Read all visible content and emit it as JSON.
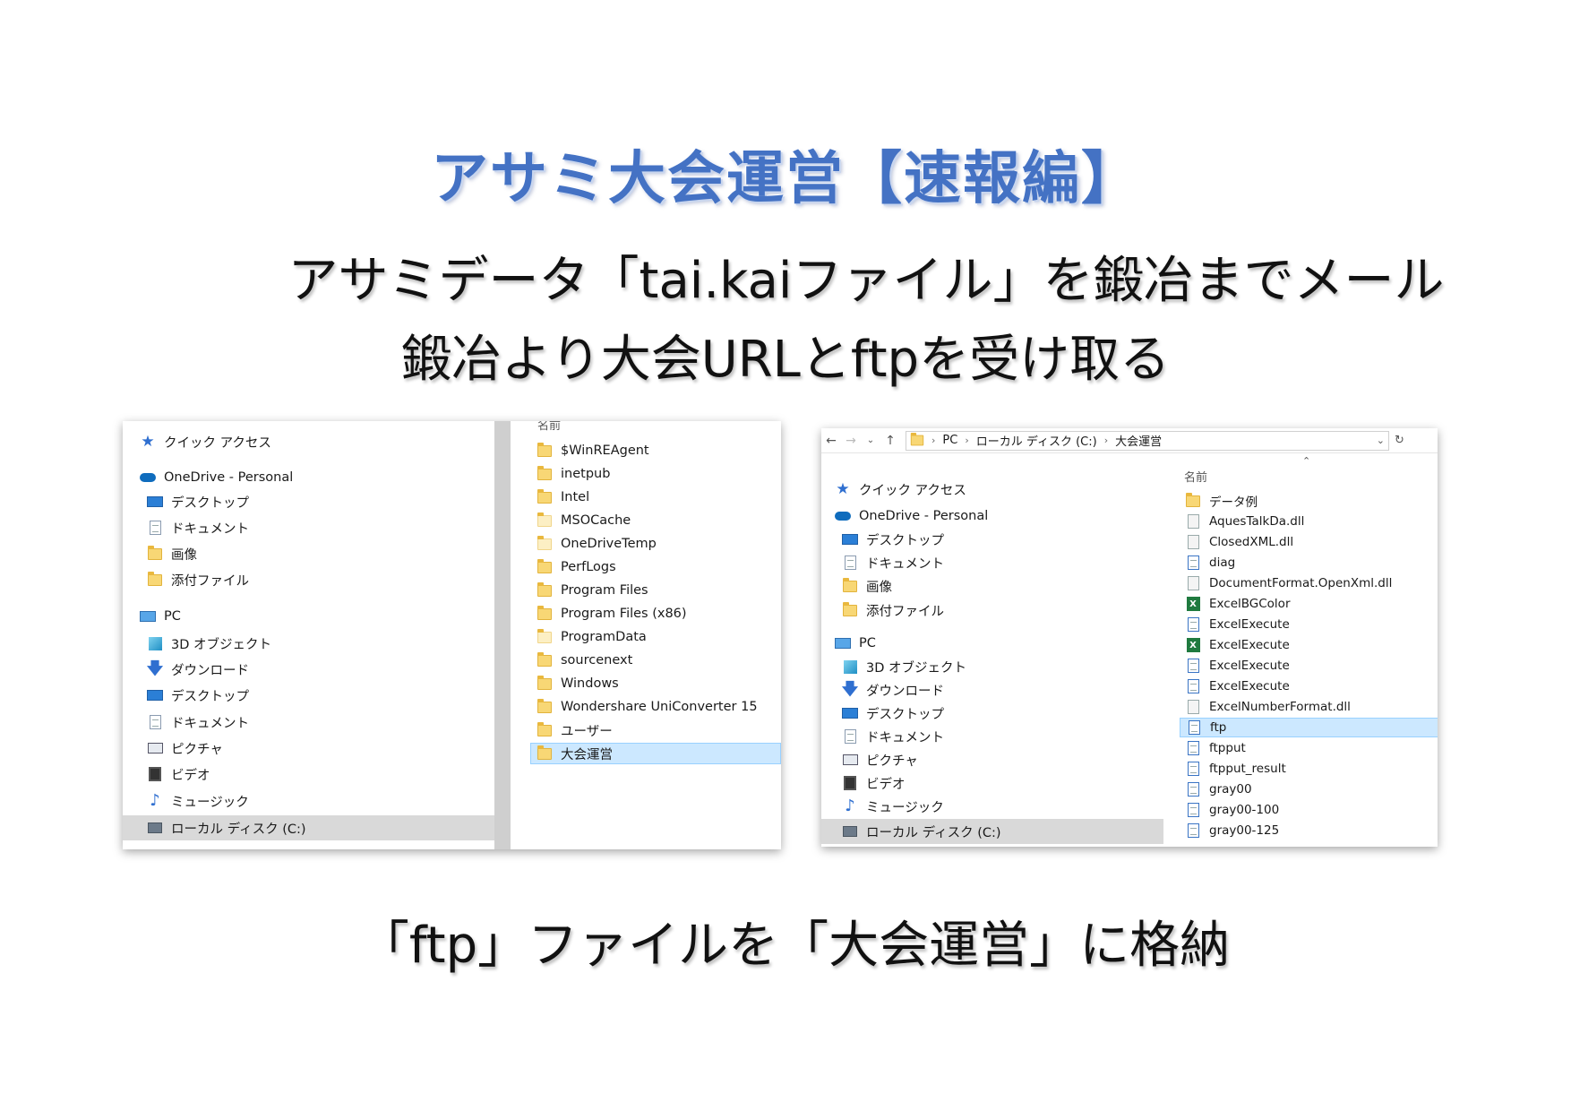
{
  "slide": {
    "title": "アサミ大会運営【速報編】",
    "line1": "アサミデータ「tai.kaiファイル」を鍛冶までメール",
    "line2": "鍛冶より大会URLとftpを受け取る",
    "line3": "「ftp」ファイルを「大会運営」に格納"
  },
  "left_explorer": {
    "nav": [
      {
        "label": "クイック アクセス",
        "icon": "star-icon"
      },
      {
        "label": "OneDrive - Personal",
        "icon": "cloud-icon"
      },
      {
        "label": "デスクトップ",
        "icon": "desktop-icon"
      },
      {
        "label": "ドキュメント",
        "icon": "document-icon"
      },
      {
        "label": "画像",
        "icon": "folder-icon"
      },
      {
        "label": "添付ファイル",
        "icon": "folder-icon"
      },
      {
        "label": "PC",
        "icon": "pc-icon"
      },
      {
        "label": "3D オブジェクト",
        "icon": "cube-icon"
      },
      {
        "label": "ダウンロード",
        "icon": "download-arrow-icon"
      },
      {
        "label": "デスクトップ",
        "icon": "desktop-icon"
      },
      {
        "label": "ドキュメント",
        "icon": "document-icon"
      },
      {
        "label": "ピクチャ",
        "icon": "picture-icon"
      },
      {
        "label": "ビデオ",
        "icon": "video-icon"
      },
      {
        "label": "ミュージック",
        "icon": "music-note-icon"
      },
      {
        "label": "ローカル ディスク (C:)",
        "icon": "drive-icon"
      }
    ],
    "column_header": "名前",
    "files": [
      "$WinREAgent",
      "inetpub",
      "Intel",
      "MSOCache",
      "OneDriveTemp",
      "PerfLogs",
      "Program Files",
      "Program Files (x86)",
      "ProgramData",
      "sourcenext",
      "Windows",
      "Wondershare UniConverter 15",
      "ユーザー",
      "大会運営"
    ]
  },
  "right_explorer": {
    "address": {
      "crumbs": [
        "PC",
        "ローカル ディスク (C:)",
        "大会運営"
      ]
    },
    "nav": [
      {
        "label": "クイック アクセス",
        "icon": "star-icon"
      },
      {
        "label": "OneDrive - Personal",
        "icon": "cloud-icon"
      },
      {
        "label": "デスクトップ",
        "icon": "desktop-icon"
      },
      {
        "label": "ドキュメント",
        "icon": "document-icon"
      },
      {
        "label": "画像",
        "icon": "folder-icon"
      },
      {
        "label": "添付ファイル",
        "icon": "folder-icon"
      },
      {
        "label": "PC",
        "icon": "pc-icon"
      },
      {
        "label": "3D オブジェクト",
        "icon": "cube-icon"
      },
      {
        "label": "ダウンロード",
        "icon": "download-arrow-icon"
      },
      {
        "label": "デスクトップ",
        "icon": "desktop-icon"
      },
      {
        "label": "ドキュメント",
        "icon": "document-icon"
      },
      {
        "label": "ピクチャ",
        "icon": "picture-icon"
      },
      {
        "label": "ビデオ",
        "icon": "video-icon"
      },
      {
        "label": "ミュージック",
        "icon": "music-note-icon"
      },
      {
        "label": "ローカル ディスク (C:)",
        "icon": "drive-icon"
      }
    ],
    "column_header": "名前",
    "files": [
      {
        "name": "データ例",
        "icon": "folder-icon"
      },
      {
        "name": "AquesTalkDa.dll",
        "icon": "dll-icon"
      },
      {
        "name": "ClosedXML.dll",
        "icon": "dll-icon"
      },
      {
        "name": "diag",
        "icon": "file-icon"
      },
      {
        "name": "DocumentFormat.OpenXml.dll",
        "icon": "dll-icon"
      },
      {
        "name": "ExcelBGColor",
        "icon": "excel-icon"
      },
      {
        "name": "ExcelExecute",
        "icon": "file-icon"
      },
      {
        "name": "ExcelExecute",
        "icon": "excel-icon"
      },
      {
        "name": "ExcelExecute",
        "icon": "file-icon"
      },
      {
        "name": "ExcelExecute",
        "icon": "file-icon"
      },
      {
        "name": "ExcelNumberFormat.dll",
        "icon": "dll-icon"
      },
      {
        "name": "ftp",
        "icon": "file-icon"
      },
      {
        "name": "ftpput",
        "icon": "file-icon"
      },
      {
        "name": "ftpput_result",
        "icon": "file-icon"
      },
      {
        "name": "gray00",
        "icon": "file-icon"
      },
      {
        "name": "gray00-100",
        "icon": "file-icon"
      },
      {
        "name": "gray00-125",
        "icon": "file-icon"
      }
    ]
  }
}
